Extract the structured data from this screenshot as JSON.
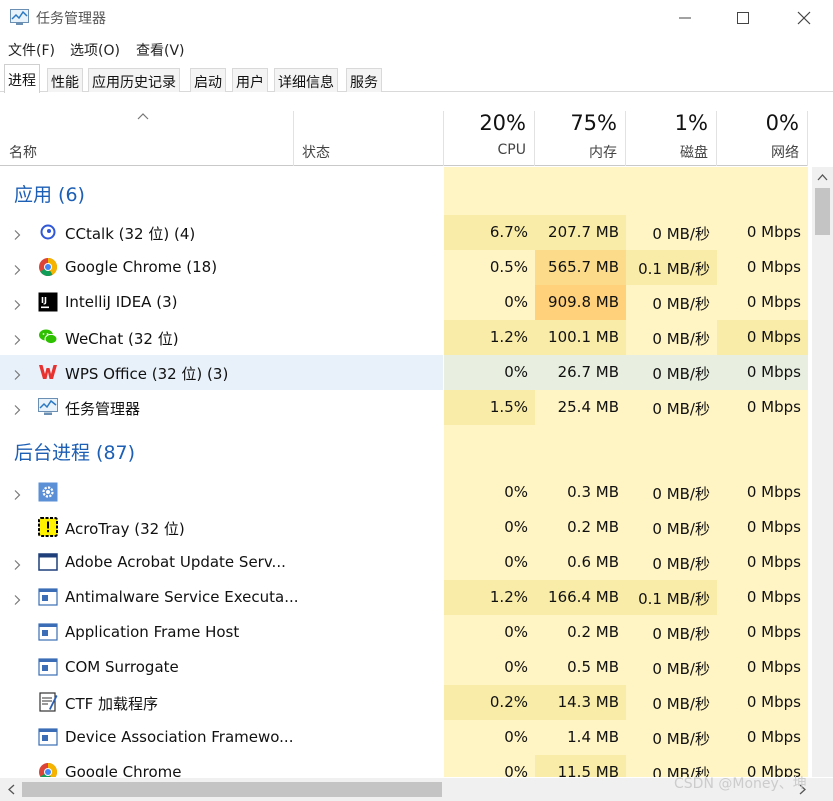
{
  "window": {
    "title": "任务管理器"
  },
  "menu": [
    "文件(F)",
    "选项(O)",
    "查看(V)"
  ],
  "tabs": [
    "进程",
    "性能",
    "应用历史记录",
    "启动",
    "用户",
    "详细信息",
    "服务"
  ],
  "active_tab": 0,
  "columns": {
    "name": "名称",
    "status": "状态",
    "cpu": {
      "pct": "20%",
      "label": "CPU"
    },
    "memory": {
      "pct": "75%",
      "label": "内存"
    },
    "disk": {
      "pct": "1%",
      "label": "磁盘"
    },
    "network": {
      "pct": "0%",
      "label": "网络"
    }
  },
  "groups": [
    {
      "title": "应用 (6)",
      "rows": [
        {
          "name": "CCtalk (32 位) (4)",
          "icon": "cctalk-icon",
          "expandable": true,
          "cpu": "6.7%",
          "mem": "207.7 MB",
          "disk": "0 MB/秒",
          "net": "0 Mbps",
          "cpu_heat": 1,
          "mem_heat": 1,
          "disk_heat": 0,
          "net_heat": 0
        },
        {
          "name": "Google Chrome (18)",
          "icon": "chrome-icon",
          "expandable": true,
          "cpu": "0.5%",
          "mem": "565.7 MB",
          "disk": "0.1 MB/秒",
          "net": "0 Mbps",
          "cpu_heat": 0,
          "mem_heat": 2,
          "disk_heat": 1,
          "net_heat": 0
        },
        {
          "name": "IntelliJ IDEA (3)",
          "icon": "intellij-icon",
          "expandable": true,
          "cpu": "0%",
          "mem": "909.8 MB",
          "disk": "0 MB/秒",
          "net": "0 Mbps",
          "cpu_heat": 0,
          "mem_heat": 3,
          "disk_heat": 0,
          "net_heat": 0
        },
        {
          "name": "WeChat (32 位)",
          "icon": "wechat-icon",
          "expandable": true,
          "cpu": "1.2%",
          "mem": "100.1 MB",
          "disk": "0 MB/秒",
          "net": "0 Mbps",
          "cpu_heat": 1,
          "mem_heat": 1,
          "disk_heat": 0,
          "net_heat": 1
        },
        {
          "name": "WPS Office (32 位) (3)",
          "icon": "wps-icon",
          "expandable": true,
          "highlight": true,
          "cpu": "0%",
          "mem": "26.7 MB",
          "disk": "0 MB/秒",
          "net": "0 Mbps",
          "cpu_heat": 0,
          "mem_heat": 0,
          "disk_heat": 0,
          "net_heat": 0
        },
        {
          "name": "任务管理器",
          "icon": "task-manager-icon",
          "expandable": true,
          "cpu": "1.5%",
          "mem": "25.4 MB",
          "disk": "0 MB/秒",
          "net": "0 Mbps",
          "cpu_heat": 1,
          "mem_heat": 0,
          "disk_heat": 0,
          "net_heat": 0
        }
      ]
    },
    {
      "title": "后台进程 (87)",
      "rows": [
        {
          "name": "",
          "icon": "gear-icon",
          "expandable": true,
          "cpu": "0%",
          "mem": "0.3 MB",
          "disk": "0 MB/秒",
          "net": "0 Mbps",
          "cpu_heat": 0,
          "mem_heat": 0,
          "disk_heat": 0,
          "net_heat": 0
        },
        {
          "name": "AcroTray (32 位)",
          "icon": "acrotray-icon",
          "expandable": false,
          "cpu": "0%",
          "mem": "0.2 MB",
          "disk": "0 MB/秒",
          "net": "0 Mbps",
          "cpu_heat": 0,
          "mem_heat": 0,
          "disk_heat": 0,
          "net_heat": 0
        },
        {
          "name": "Adobe Acrobat Update Serv...",
          "icon": "window-icon",
          "expandable": true,
          "cpu": "0%",
          "mem": "0.6 MB",
          "disk": "0 MB/秒",
          "net": "0 Mbps",
          "cpu_heat": 0,
          "mem_heat": 0,
          "disk_heat": 0,
          "net_heat": 0
        },
        {
          "name": "Antimalware Service Executa...",
          "icon": "service-icon",
          "expandable": true,
          "cpu": "1.2%",
          "mem": "166.4 MB",
          "disk": "0.1 MB/秒",
          "net": "0 Mbps",
          "cpu_heat": 1,
          "mem_heat": 1,
          "disk_heat": 1,
          "net_heat": 0
        },
        {
          "name": "Application Frame Host",
          "icon": "service-icon",
          "expandable": false,
          "cpu": "0%",
          "mem": "0.2 MB",
          "disk": "0 MB/秒",
          "net": "0 Mbps",
          "cpu_heat": 0,
          "mem_heat": 0,
          "disk_heat": 0,
          "net_heat": 0
        },
        {
          "name": "COM Surrogate",
          "icon": "service-icon",
          "expandable": false,
          "cpu": "0%",
          "mem": "0.5 MB",
          "disk": "0 MB/秒",
          "net": "0 Mbps",
          "cpu_heat": 0,
          "mem_heat": 0,
          "disk_heat": 0,
          "net_heat": 0
        },
        {
          "name": "CTF 加载程序",
          "icon": "ctf-icon",
          "expandable": false,
          "cpu": "0.2%",
          "mem": "14.3 MB",
          "disk": "0 MB/秒",
          "net": "0 Mbps",
          "cpu_heat": 1,
          "mem_heat": 1,
          "disk_heat": 0,
          "net_heat": 0
        },
        {
          "name": "Device Association Framewo...",
          "icon": "service-icon",
          "expandable": false,
          "cpu": "0%",
          "mem": "1.4 MB",
          "disk": "0 MB/秒",
          "net": "0 Mbps",
          "cpu_heat": 0,
          "mem_heat": 0,
          "disk_heat": 0,
          "net_heat": 0
        },
        {
          "name": "Google Chrome",
          "icon": "chrome-icon",
          "expandable": false,
          "cpu": "0%",
          "mem": "11.5 MB",
          "disk": "0 MB/秒",
          "net": "0 Mbps",
          "cpu_heat": 0,
          "mem_heat": 1,
          "disk_heat": 0,
          "net_heat": 0
        }
      ]
    }
  ],
  "heat_colors": [
    "#fff4c4",
    "#f9eca8",
    "#fcdc8a",
    "#ffd17a"
  ],
  "watermark": "CSDN @Money、坤"
}
